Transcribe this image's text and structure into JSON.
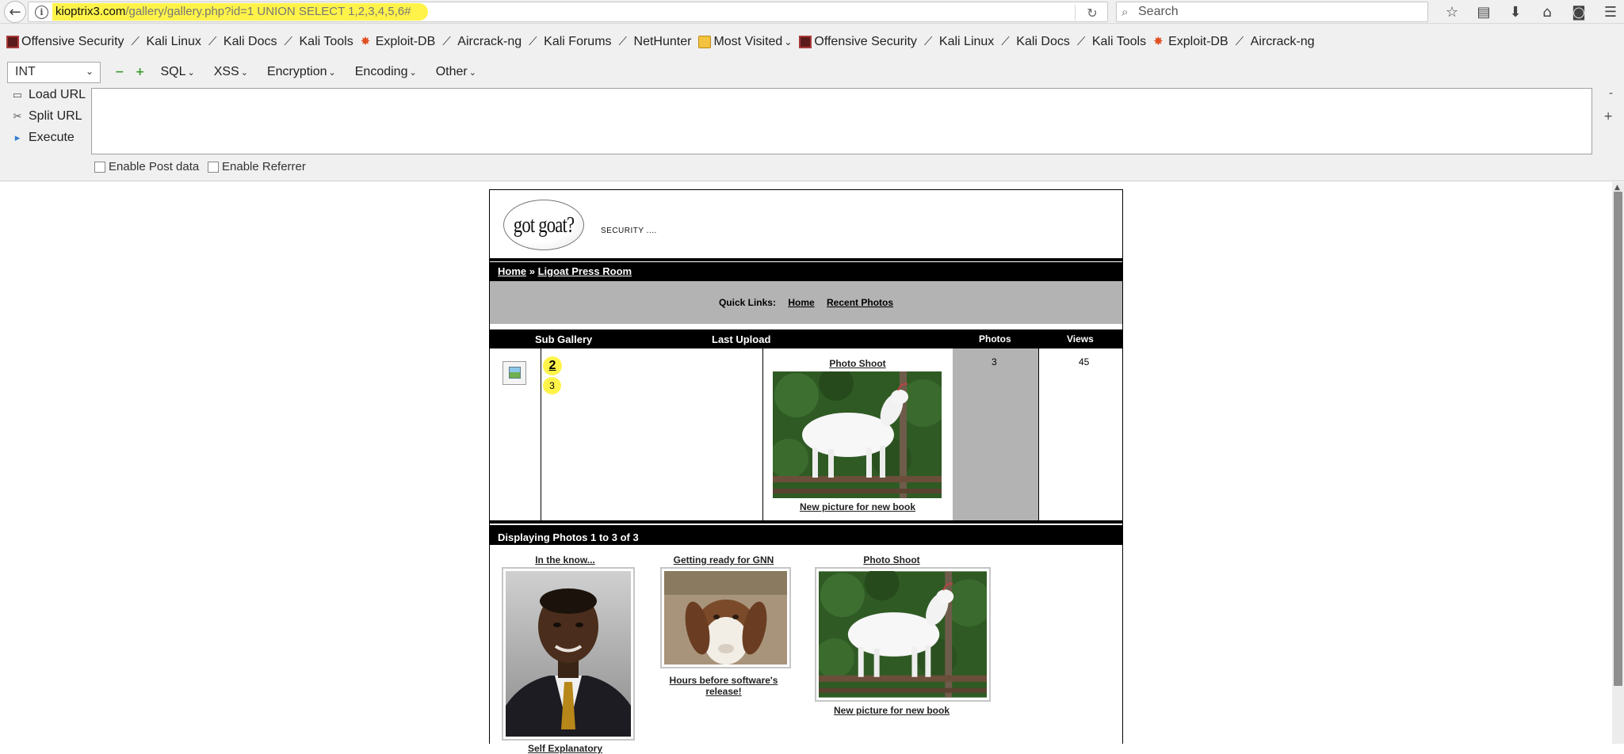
{
  "browser": {
    "url_host": "kioptrix3.com",
    "url_path": "/gallery/gallery.php?id=1 UNION SELECT 1,2,3,4,5,6#",
    "search_placeholder": "Search"
  },
  "bookmarks": [
    {
      "label": "Offensive Security",
      "icon": "os"
    },
    {
      "label": "Kali Linux",
      "icon": "dragon"
    },
    {
      "label": "Kali Docs",
      "icon": "dragon"
    },
    {
      "label": "Kali Tools",
      "icon": "dragon"
    },
    {
      "label": "Exploit-DB",
      "icon": "edb"
    },
    {
      "label": "Aircrack-ng",
      "icon": "dragon"
    },
    {
      "label": "Kali Forums",
      "icon": "dragon"
    },
    {
      "label": "NetHunter",
      "icon": "dragon"
    },
    {
      "label": "Most Visited",
      "icon": "folder"
    },
    {
      "label": "Offensive Security",
      "icon": "os"
    },
    {
      "label": "Kali Linux",
      "icon": "dragon"
    },
    {
      "label": "Kali Docs",
      "icon": "dragon"
    },
    {
      "label": "Kali Tools",
      "icon": "dragon"
    },
    {
      "label": "Exploit-DB",
      "icon": "edb"
    },
    {
      "label": "Aircrack-ng",
      "icon": "dragon"
    }
  ],
  "hackbar": {
    "type_select": "INT",
    "menus": [
      "SQL",
      "XSS",
      "Encryption",
      "Encoding",
      "Other"
    ],
    "actions": {
      "load": "Load URL",
      "split": "Split URL",
      "execute": "Execute"
    },
    "side": {
      "minus": "-",
      "plus": "+"
    },
    "checks": {
      "post": "Enable Post data",
      "referrer": "Enable Referrer"
    }
  },
  "site": {
    "logo_text": "got goat?",
    "tagline": "SECURITY ....",
    "breadcrumb": {
      "home": "Home",
      "sep": "»",
      "current": "Ligoat Press Room"
    },
    "quick_links": {
      "label": "Quick Links:",
      "home": "Home",
      "recent": "Recent Photos"
    },
    "table_headers": {
      "sub_gallery": "Sub Gallery",
      "last_upload": "Last Upload",
      "photos": "Photos",
      "views": "Views"
    },
    "row": {
      "injected_title": "2",
      "injected_desc": "3",
      "last_upload_title": "Photo Shoot",
      "last_upload_caption": "New picture for new book",
      "photos": "3",
      "views": "45"
    },
    "display_text": "Displaying Photos 1 to 3 of 3",
    "thumbnails": [
      {
        "title": "In the know...",
        "caption": "Self Explanatory"
      },
      {
        "title": "Getting ready for GNN",
        "caption": "Hours before software's release!"
      },
      {
        "title": "Photo Shoot",
        "caption": "New picture for new book"
      }
    ]
  }
}
